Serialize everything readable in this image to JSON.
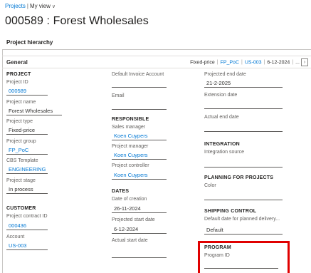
{
  "breadcrumb": {
    "projects": "Projects",
    "separator": "|",
    "view": "My view"
  },
  "page_title": "000589 : Forest Wholesales",
  "hierarchy_tab": "Project hierarchy",
  "general": {
    "label": "General",
    "summary": {
      "type": "Fixed-price",
      "group": "FP_PoC",
      "account": "US-003",
      "date": "6-12-2024",
      "more": "..."
    }
  },
  "project": {
    "heading": "PROJECT",
    "id_label": "Project ID",
    "id_value": "000589",
    "name_label": "Project name",
    "name_value": "Forest Wholesales",
    "type_label": "Project type",
    "type_value": "Fixed-price",
    "group_label": "Project group",
    "group_value": "FP_PoC",
    "cbs_label": "CBS Template",
    "cbs_value": "ENGINEERING",
    "stage_label": "Project stage",
    "stage_value": "In process"
  },
  "customer": {
    "heading": "CUSTOMER",
    "contract_label": "Project contract ID",
    "contract_value": "000436",
    "account_label": "Account",
    "account_value": "US-003"
  },
  "middle": {
    "invoice_label": "Default Invoice Account",
    "invoice_value": "",
    "email_label": "Email",
    "email_value": ""
  },
  "responsible": {
    "heading": "RESPONSIBLE",
    "sales_label": "Sales manager",
    "sales_value": "Koen Cuypers",
    "pm_label": "Project manager",
    "pm_value": "Koen Cuypers",
    "controller_label": "Project controller",
    "controller_value": "Koen Cuypers"
  },
  "dates": {
    "heading": "DATES",
    "creation_label": "Date of creation",
    "creation_value": "26-11-2024",
    "start_label": "Projected start date",
    "start_value": "6-12-2024",
    "actual_start_label": "Actual start date",
    "actual_start_value": ""
  },
  "right": {
    "end_label": "Projected end date",
    "end_value": "21-2-2025",
    "ext_label": "Extension date",
    "ext_value": "",
    "actual_end_label": "Actual end date",
    "actual_end_value": ""
  },
  "integration": {
    "heading": "INTEGRATION",
    "source_label": "Integration source",
    "source_value": ""
  },
  "planning": {
    "heading": "PLANNING FOR PROJECTS",
    "color_label": "Color",
    "color_value": ""
  },
  "shipping": {
    "heading": "SHIPPING CONTROL",
    "default_label": "Default date for planned delivery...",
    "default_value": "Default"
  },
  "program": {
    "heading": "PROGRAM",
    "id_label": "Program ID",
    "id_value": ""
  },
  "colors": {
    "link": "#0078d4",
    "highlight": "#e00000"
  }
}
